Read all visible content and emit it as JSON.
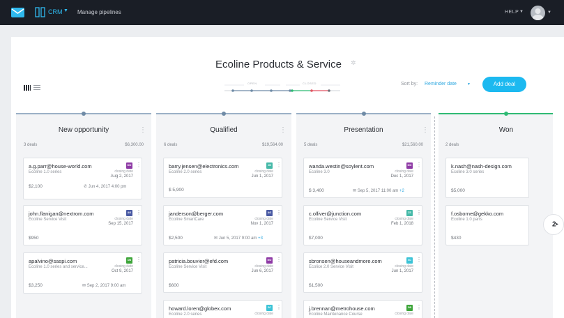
{
  "nav": {
    "crm_label": "CRM",
    "manage_pipelines": "Manage pipelines",
    "help": "HELP"
  },
  "board": {
    "title": "Ecoline Products & Service",
    "progress_open": "OPEN",
    "progress_closed": "CLOSED",
    "sort_by_label": "Sort by:",
    "sort_by_value": "Reminder date",
    "add_deal": "Add deal",
    "next_page": "2"
  },
  "columns": [
    {
      "title": "New opportunity",
      "count": "3 deals",
      "amount": "$6,300.00",
      "cards": [
        {
          "email": "a.g.parr@house-world.com",
          "product": "Ecoline 1.0 series",
          "badge": "MO",
          "badge_color": "#8e3aa5",
          "close_label": "closing date",
          "close_date": "Aug 2, 2017",
          "amount": "$2,100",
          "activity": "Jun 4, 2017   4:00 pm",
          "activity_icon": "phone-icon",
          "plus": ""
        },
        {
          "email": "john.flanigan@nextrom.com",
          "product": "Ecoline Service Visit",
          "badge": "AG",
          "badge_color": "#4a5aa3",
          "close_label": "closing date",
          "close_date": "Sep 15, 2017",
          "amount": "$950",
          "activity": "",
          "activity_icon": "",
          "plus": ""
        },
        {
          "email": "apalvino@saspi.com",
          "product": "Ecoline 1.0 series and service...",
          "badge": "DB",
          "badge_color": "#3ea53a",
          "close_label": "closing date",
          "close_date": "Oct 9, 2017",
          "amount": "$3,250",
          "activity": "Sep 2, 2017   9:00 am",
          "activity_icon": "mail-icon",
          "plus": ""
        }
      ]
    },
    {
      "title": "Qualified",
      "count": "6 deals",
      "amount": "$19,564.00",
      "cards": [
        {
          "email": "barry.jensen@electronics.com",
          "product": "Ecoline 2.0 series",
          "badge": "JB",
          "badge_color": "#46b9a8",
          "close_label": "closing date",
          "close_date": "Jun 1, 2017",
          "amount": "$ 5,900",
          "activity": "",
          "activity_icon": "",
          "plus": ""
        },
        {
          "email": "janderson@berger.com",
          "product": "Ecoline SmartCare",
          "badge": "AG",
          "badge_color": "#4a5aa3",
          "close_label": "closing date",
          "close_date": "Nov 1, 2017",
          "amount": "$2,500",
          "activity": "Jun 5, 2017   9:00 am",
          "activity_icon": "mail-icon",
          "plus": "+3"
        },
        {
          "email": "patricia.bouvier@efd.com",
          "product": "Ecoline Service Visit",
          "badge": "MO",
          "badge_color": "#8e3aa5",
          "close_label": "closing date",
          "close_date": "Jun 6, 2017",
          "amount": "$600",
          "activity": "",
          "activity_icon": "",
          "plus": ""
        },
        {
          "email": "howard.loren@globex.com",
          "product": "Ecoline 2.0 series",
          "badge": "SC",
          "badge_color": "#3cc3d6",
          "close_label": "closing date",
          "close_date": "",
          "amount": "",
          "activity": "",
          "activity_icon": "",
          "plus": ""
        }
      ]
    },
    {
      "title": "Presentation",
      "count": "5 deals",
      "amount": "$21,560.00",
      "cards": [
        {
          "email": "wanda.westin@soylent.com",
          "product": "Ecoline 3.0",
          "badge": "MO",
          "badge_color": "#8e3aa5",
          "close_label": "closing date",
          "close_date": "Dec 1, 2017",
          "amount": "$ 3,400",
          "activity": "Sep 5, 2017   11:00 am",
          "activity_icon": "mail-icon",
          "plus": "+2"
        },
        {
          "email": "c.olliver@junction.com",
          "product": "Ecoline Service Visit",
          "badge": "ZS",
          "badge_color": "#46b9a8",
          "close_label": "closing date",
          "close_date": "Feb 1, 2018",
          "amount": "$7,000",
          "activity": "",
          "activity_icon": "",
          "plus": ""
        },
        {
          "email": "sbronsen@houseandmore.com",
          "product": "Ecolice 2.0 Service Visit",
          "badge": "SC",
          "badge_color": "#3cc3d6",
          "close_label": "closing date",
          "close_date": "Jun 1, 2017",
          "amount": "$1,500",
          "activity": "",
          "activity_icon": "",
          "plus": ""
        },
        {
          "email": "j.brennan@metrohouse.com",
          "product": "Ecoline Maintenance Course",
          "badge": "DB",
          "badge_color": "#3ea53a",
          "close_label": "closing date",
          "close_date": "",
          "amount": "",
          "activity": "",
          "activity_icon": "",
          "plus": ""
        }
      ]
    },
    {
      "title": "Won",
      "count": "2 deals",
      "amount": "",
      "cards": [
        {
          "email": "k.nash@nash-design.com",
          "product": "Ecoline 3.0 series",
          "amount": "$5,000"
        },
        {
          "email": "f.osborne@gekko.com",
          "product": "Ecoline 1.0 parts",
          "amount": "$430"
        }
      ]
    }
  ],
  "colors": {
    "topbar": "#1a1e26",
    "accent": "#1cb9f0",
    "won": "#2fba74"
  }
}
